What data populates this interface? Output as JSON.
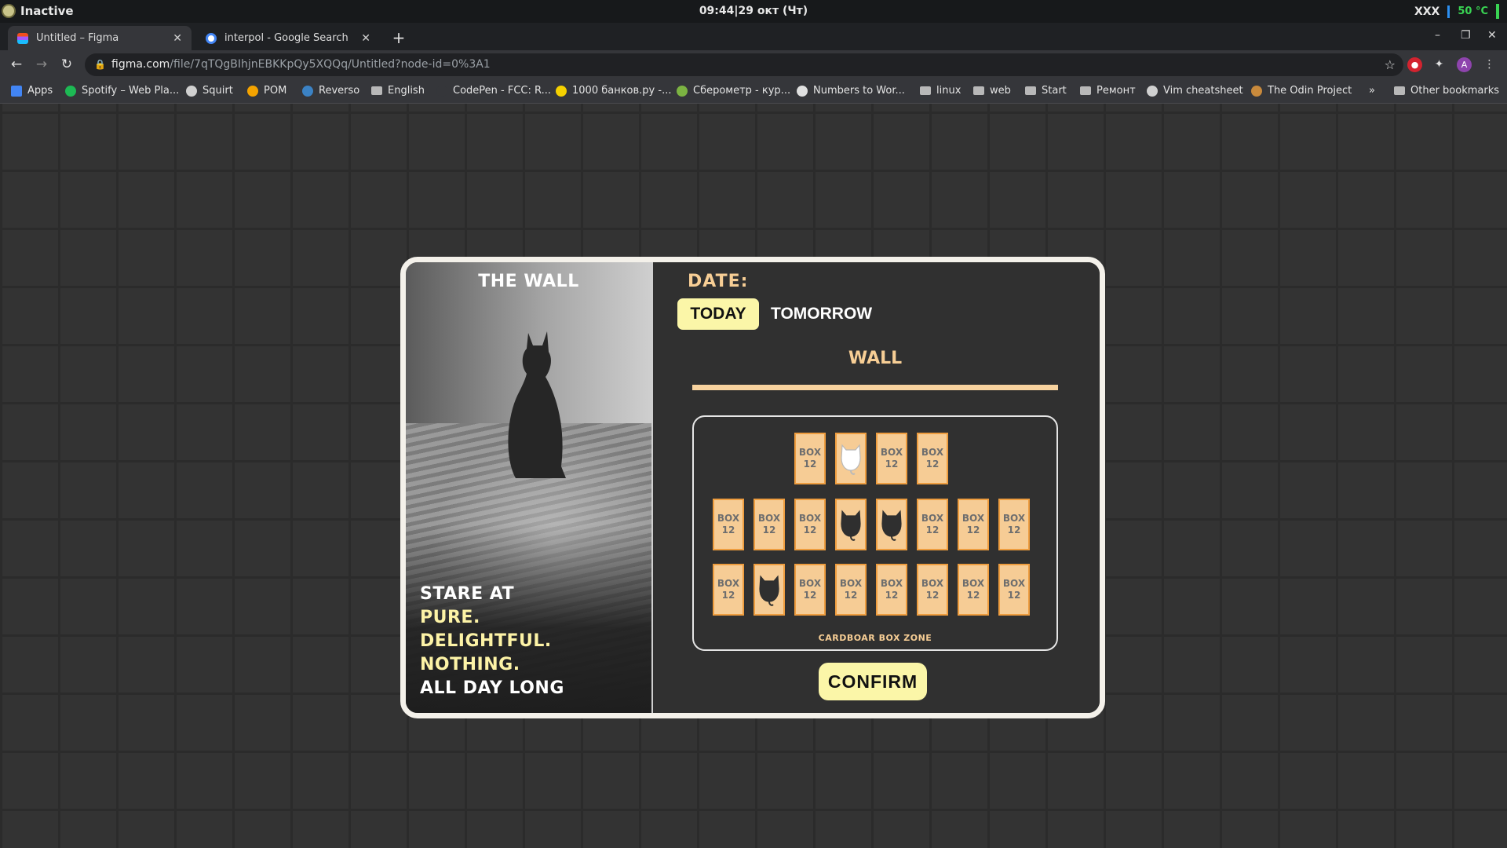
{
  "system": {
    "status": "Inactive",
    "clock": "09:44|29 окт (Чт)",
    "user": "XXX",
    "temperature": "50 °C"
  },
  "tabs": [
    {
      "title": "Untitled – Figma",
      "active": true,
      "favicon": "figma-icon"
    },
    {
      "title": "interpol - Google Search",
      "active": false,
      "favicon": "google-icon"
    }
  ],
  "address": {
    "host": "figma.com",
    "path": "/file/7qTQgBIhjnEBKKpQy5XQQq/Untitled?node-id=0%3A1"
  },
  "bookmarks": [
    {
      "label": "Apps",
      "icon": "apps-grid-icon",
      "color": "#4285f4"
    },
    {
      "label": "Spotify – Web Pla...",
      "icon": "spotify-icon",
      "color": "#1db954"
    },
    {
      "label": "Squirt",
      "icon": "globe-icon",
      "color": "#d0d0d0"
    },
    {
      "label": "POM",
      "icon": "circle-icon",
      "color": "#f4a300"
    },
    {
      "label": "Reverso",
      "icon": "reverso-icon",
      "color": "#3b82c4"
    },
    {
      "label": "English",
      "icon": "folder-icon",
      "color": "#b8b8b8"
    },
    {
      "label": "CodePen - FCC: R...",
      "icon": "codepen-icon",
      "color": "#35363a"
    },
    {
      "label": "1000 банков.ру -...",
      "icon": "banki-icon",
      "color": "#f5d100"
    },
    {
      "label": "Сберометр - кур...",
      "icon": "sberometr-icon",
      "color": "#7cb342"
    },
    {
      "label": "Numbers to Wor...",
      "icon": "sigma-icon",
      "color": "#e0e0e0"
    },
    {
      "label": "linux",
      "icon": "folder-icon",
      "color": "#b8b8b8"
    },
    {
      "label": "web",
      "icon": "folder-icon",
      "color": "#b8b8b8"
    },
    {
      "label": "Start",
      "icon": "folder-icon",
      "color": "#b8b8b8"
    },
    {
      "label": "Ремонт",
      "icon": "folder-icon",
      "color": "#b8b8b8"
    },
    {
      "label": "Vim cheatsheet",
      "icon": "globe-icon",
      "color": "#d0d0d0"
    },
    {
      "label": "The Odin Project",
      "icon": "odin-icon",
      "color": "#c98a3c"
    }
  ],
  "bookmarks_more": "»",
  "other_bookmarks": "Other bookmarks",
  "card": {
    "photo_title": "THE WALL",
    "tagline": [
      {
        "text": "STARE AT",
        "highlight": false
      },
      {
        "text": "PURE.",
        "highlight": true
      },
      {
        "text": "DELIGHTFUL.",
        "highlight": true
      },
      {
        "text": "NOTHING.",
        "highlight": true
      },
      {
        "text": "ALL DAY LONG",
        "highlight": false
      }
    ],
    "date_label": "DATE:",
    "today": "TODAY",
    "tomorrow": "TOMORROW",
    "wall_title": "WALL",
    "zone_label": "CARDBOAR BOX ZONE",
    "confirm": "CONFIRM",
    "seat_text": [
      "BOX",
      "12"
    ],
    "rows": [
      [
        "box",
        "cat-white",
        "box",
        "box"
      ],
      [
        "box",
        "box",
        "box",
        "cat-black",
        "cat-black",
        "box",
        "box",
        "box"
      ],
      [
        "box",
        "cat-black",
        "box",
        "box",
        "box",
        "box",
        "box",
        "box"
      ]
    ]
  },
  "colors": {
    "accent_yellow": "#fbf6a8",
    "accent_peach": "#f7ce95",
    "seat_fill": "#f6cc95",
    "seat_border": "#ee9d3f"
  }
}
